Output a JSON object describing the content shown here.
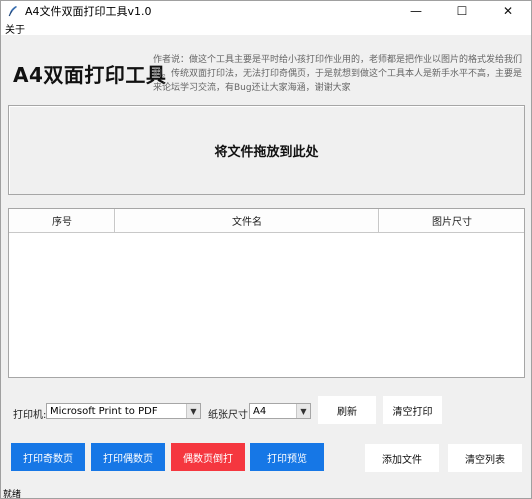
{
  "window": {
    "title": "A4文件双面打印工具v1.0",
    "minimize_glyph": "—",
    "maximize_glyph": "☐",
    "close_glyph": "✕"
  },
  "menu": {
    "items": [
      "关于"
    ]
  },
  "header": {
    "title": "A4双面打印工具",
    "author_note": "作者说：做这个工具主要是平时给小孩打印作业用的，老师都是把作业以图片的格式发给我们的。传统双面打印法，无法打印奇偶页，于是就想到做这个工具本人是新手水平不高，主要是来论坛学习交流，有Bug还让大家海涵，谢谢大家"
  },
  "dropzone": {
    "label": "将文件拖放到此处"
  },
  "table": {
    "columns": [
      "序号",
      "文件名",
      "图片尺寸"
    ],
    "rows": []
  },
  "controls": {
    "printer_label": "打印机:",
    "printer_value": "Microsoft Print to PDF",
    "paper_label": "纸张尺寸:",
    "paper_value": "A4",
    "refresh_label": "刷新",
    "clear_print_label": "清空打印"
  },
  "actions": {
    "print_odd": "打印奇数页",
    "print_even": "打印偶数页",
    "even_reverse": "偶数页倒打",
    "print_preview": "打印预览",
    "add_file": "添加文件",
    "clear_list": "清空列表"
  },
  "colors": {
    "blue_button": "#1677e6",
    "red_button": "#f5373f"
  },
  "status": {
    "text": "就绪"
  }
}
